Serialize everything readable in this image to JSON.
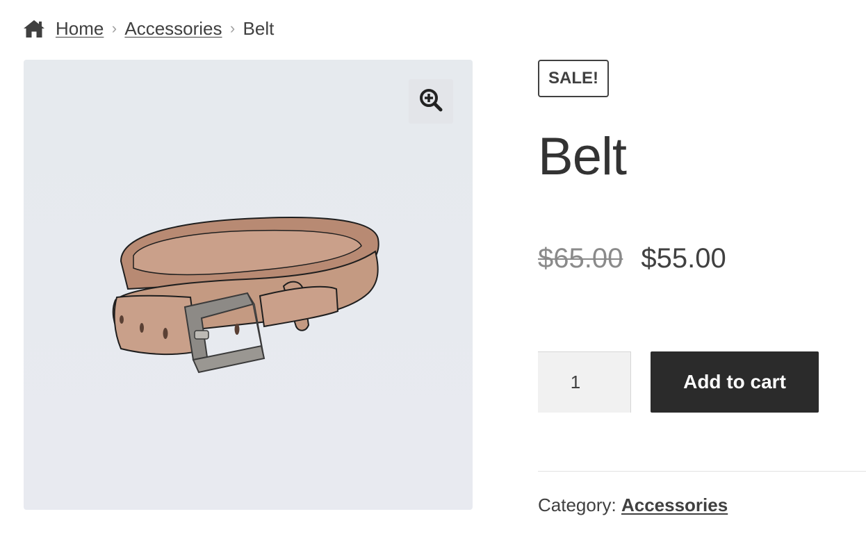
{
  "breadcrumb": {
    "home_icon": "home-icon",
    "items": [
      {
        "label": "Home"
      },
      {
        "label": "Accessories"
      }
    ],
    "current": "Belt",
    "separator": "›"
  },
  "gallery": {
    "zoom_icon": "zoom-in-icon",
    "image_subject": "belt"
  },
  "product": {
    "badge": "SALE!",
    "title": "Belt",
    "price_old": "$65.00",
    "price_new": "$55.00",
    "quantity": "1",
    "add_to_cart_label": "Add to cart",
    "category_label": "Category:",
    "category_value": "Accessories"
  },
  "colors": {
    "button_bg": "#2b2b2b",
    "text": "#404040",
    "gallery_bg": "#e6eaee",
    "belt_leather": "#c49a82"
  }
}
